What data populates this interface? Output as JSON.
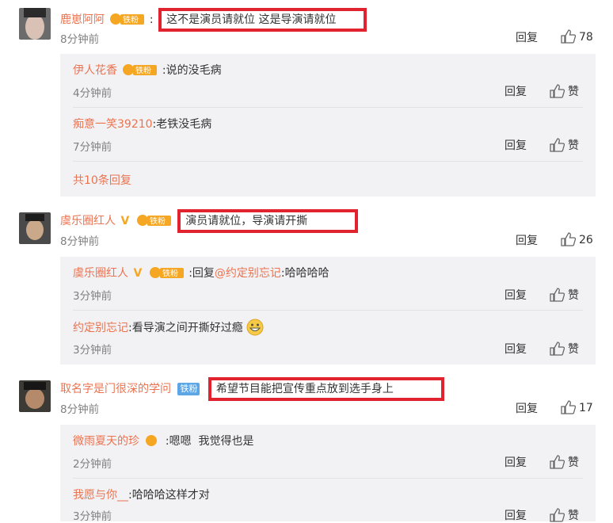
{
  "ui": {
    "reply": "回复",
    "like": "赞",
    "fan_badge": "铁粉"
  },
  "comments": [
    {
      "user": "鹿崽阿阿",
      "text": "这不是演员请就位 这是导演请就位",
      "time": "8分钟前",
      "likes": "78",
      "replies": [
        {
          "user": "伊人花香",
          "text": "说的没毛病",
          "time": "4分钟前"
        },
        {
          "user": "痴意一笑39210",
          "text": "老铁没毛病",
          "time": "7分钟前"
        }
      ],
      "more": "共10条回复"
    },
    {
      "user": "虞乐圈红人",
      "text": "演员请就位，导演请开撕",
      "time": "8分钟前",
      "likes": "26",
      "replies": [
        {
          "user": "虞乐圈红人",
          "prefix": "回复",
          "mention": "@约定别忘记",
          "text": ":哈哈哈哈",
          "time": "3分钟前"
        },
        {
          "user": "约定别忘记",
          "text": "看导演之间开撕好过瘾",
          "time": "3分钟前"
        }
      ]
    },
    {
      "user": "取名字是门很深的学问",
      "text": "希望节目能把宣传重点放到选手身上",
      "time": "8分钟前",
      "likes": "17",
      "replies": [
        {
          "user": "微雨夏天的珍",
          "text": "嗯嗯  我觉得也是",
          "time": "2分钟前"
        },
        {
          "user": "我愿与你__",
          "text": "哈哈哈这样才对",
          "time": "3分钟前"
        }
      ]
    }
  ],
  "colors": {
    "name": "#eb7350",
    "highlight_box": "#e0232f",
    "reply_bg": "#f2f2f5",
    "meta": "#808080"
  }
}
